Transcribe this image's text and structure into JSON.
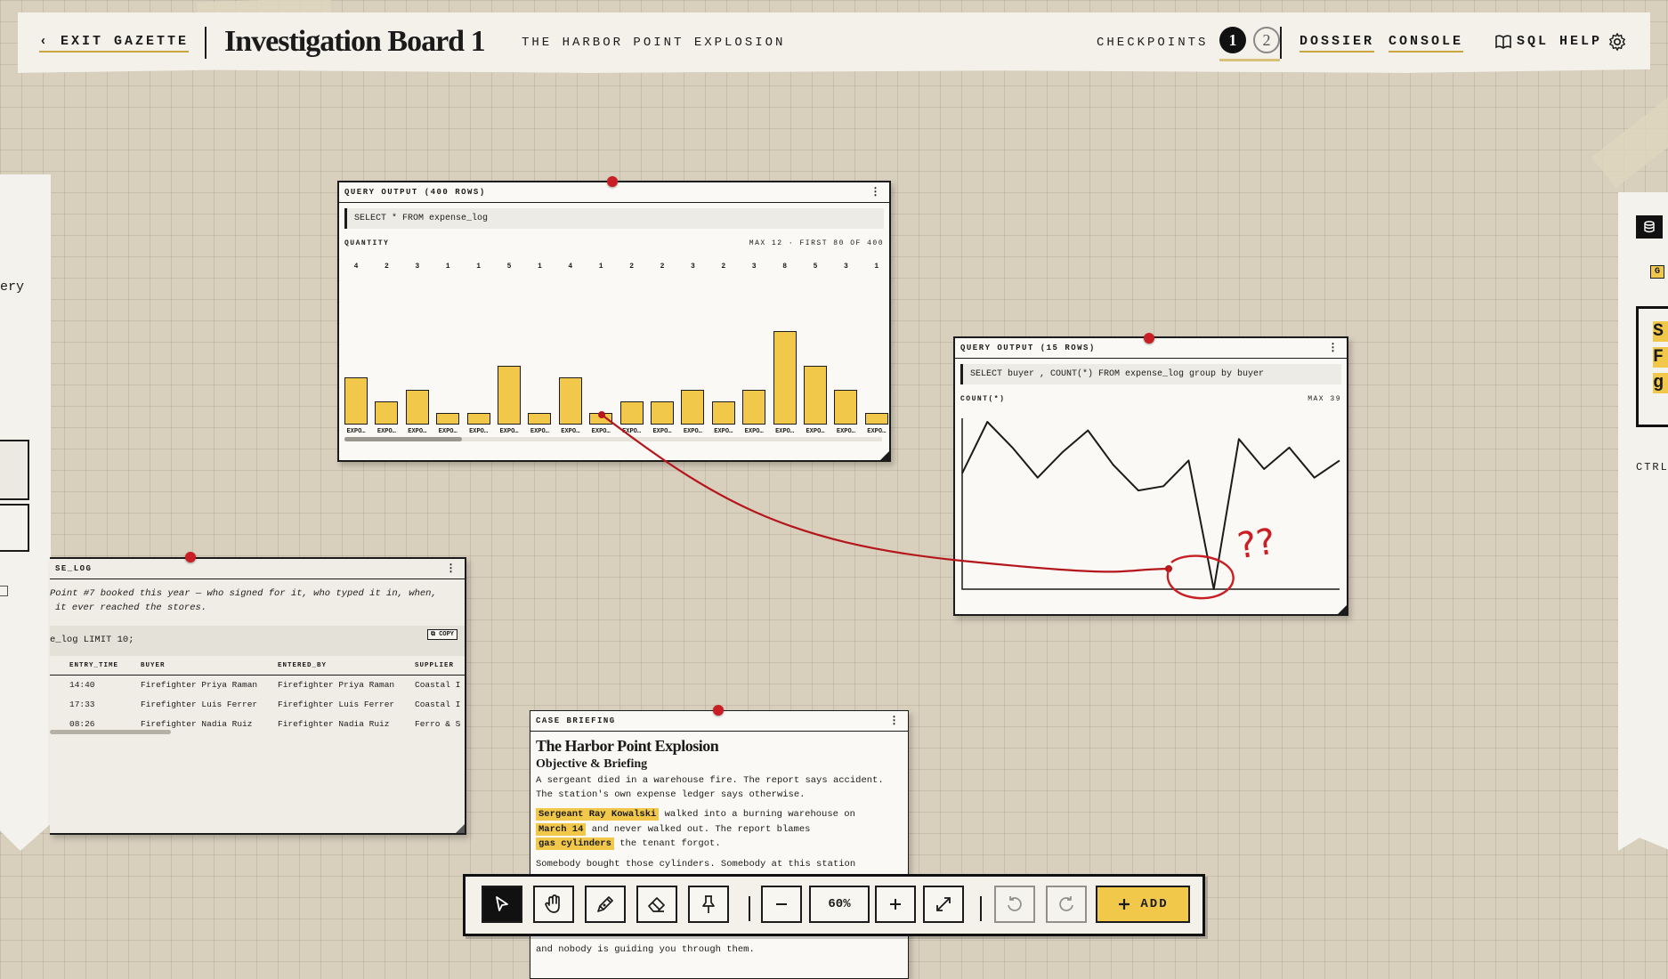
{
  "header": {
    "exit_label": "‹ EXIT GAZETTE",
    "title": "Investigation Board 1",
    "subtitle": "THE HARBOR POINT EXPLOSION",
    "checkpoints_label": "CHECKPOINTS",
    "checkpoints": [
      "1",
      "2"
    ],
    "nav": {
      "dossier": "DOSSIER",
      "console": "CONSOLE",
      "sql_help": "SQL HELP"
    },
    "icons": {
      "sql_help": "book-icon",
      "settings": "gear-icon"
    }
  },
  "bar_card": {
    "title": "QUERY OUTPUT (400 ROWS)",
    "query": "SELECT * FROM expense_log",
    "axis_label": "QUANTITY",
    "meta": "MAX 12 · FIRST 80 OF 400"
  },
  "line_card": {
    "title": "QUERY OUTPUT (15 ROWS)",
    "query": "SELECT buyer , COUNT(*) FROM expense_log group by buyer",
    "axis_label": "COUNT(*)",
    "meta": "MAX 39"
  },
  "chart_data": [
    {
      "type": "bar",
      "ylabel": "QUANTITY",
      "categories": [
        "EXPO…",
        "EXPO…",
        "EXPO…",
        "EXPO…",
        "EXPO…",
        "EXPO…",
        "EXPO…",
        "EXPO…",
        "EXPO…",
        "EXPO…",
        "EXPO…",
        "EXPO…",
        "EXPO…",
        "EXPO…",
        "EXPO…",
        "EXPO…",
        "EXPO…",
        "EXPO…"
      ],
      "value_labels": [
        "4",
        "2",
        "3",
        "1",
        "1",
        "5",
        "1",
        "4",
        "1",
        "2",
        "2",
        "3",
        "2",
        "3",
        "8",
        "5",
        "3",
        "1"
      ],
      "values": [
        4,
        2,
        3,
        1,
        1,
        5,
        1,
        4,
        1,
        2,
        2,
        3,
        2,
        3,
        8,
        5,
        3,
        1
      ],
      "ylim": [
        0,
        12
      ]
    },
    {
      "type": "line",
      "ylabel": "COUNT(*)",
      "values": [
        27,
        39,
        33,
        26,
        32,
        37,
        29,
        23,
        24,
        30,
        0,
        35,
        28,
        33,
        26,
        30
      ],
      "ylim": [
        0,
        39
      ]
    }
  ],
  "table_card": {
    "title": "SE_LOG",
    "description_line1": "Point #7 booked this year — who signed for it, who typed it in, when,",
    "description_line2": "it ever reached the stores.",
    "query": "e_log LIMIT 10;",
    "copy_label": "COPY",
    "columns": [
      "ENTRY_TIME",
      "BUYER",
      "ENTERED_BY",
      "SUPPLIER"
    ],
    "rows": [
      [
        "14:40",
        "Firefighter Priya Raman",
        "Firefighter Priya Raman",
        "Coastal I"
      ],
      [
        "17:33",
        "Firefighter Luis Ferrer",
        "Firefighter Luis Ferrer",
        "Coastal I"
      ],
      [
        "08:26",
        "Firefighter Nadia Ruiz",
        "Firefighter Nadia Ruiz",
        "Ferro & S"
      ]
    ]
  },
  "briefing": {
    "header": "CASE BRIEFING",
    "title": "The Harbor Point Explosion",
    "subtitle": "Objective & Briefing",
    "para1": "A sergeant died in a warehouse fire. The report says accident. The station's own expense ledger says otherwise.",
    "hl1": "Sergeant Ray Kowalski",
    "text1": " walked into a burning warehouse on",
    "hl2": "March 14",
    "text2": " and never walked out. The report blames",
    "hl3": "gas cylinders",
    "text3": " the tenant forgot.",
    "para3": "Somebody bought those cylinders. Somebody at this station",
    "para_bottom": "and nobody is guiding you through them."
  },
  "annotation": {
    "scribble": "??"
  },
  "left_panel": {
    "fragment": "ery"
  },
  "right_panel": {
    "badge": "G",
    "big_letters": [
      "S",
      "F",
      "g"
    ],
    "ctrl": "CTRL"
  },
  "toolbar": {
    "tools": [
      "select-icon",
      "hand-icon",
      "pen-icon",
      "eraser-icon",
      "pin-icon"
    ],
    "zoom": "60%",
    "add_label": "ADD"
  },
  "colors": {
    "accent": "#f2c84b",
    "pin": "#c81e24",
    "ink": "#1b1b1b",
    "paper": "#faf9f5",
    "board": "#d8cfbd"
  }
}
